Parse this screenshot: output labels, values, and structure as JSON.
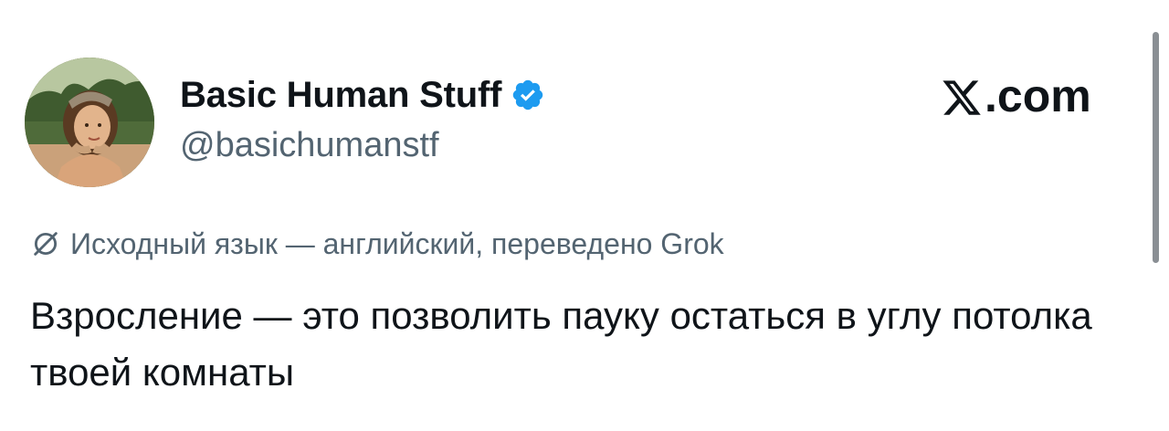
{
  "header": {
    "display_name": "Basic Human Stuff",
    "handle": "@basichumanstf",
    "verified": true,
    "brand_text": ".com",
    "brand_icon": "x-logo-icon",
    "avatar_icon": "avatar-photo",
    "accent_color": "#1d9bf0"
  },
  "translation": {
    "icon": "translate-icon",
    "note": "Исходный язык — английский, переведено Grok"
  },
  "tweet": {
    "text": "Взросление — это позволить пауку остаться в углу потолка твоей комнаты"
  },
  "colors": {
    "text_primary": "#0f1419",
    "text_secondary": "#536471",
    "verified_blue": "#1d9bf0"
  }
}
